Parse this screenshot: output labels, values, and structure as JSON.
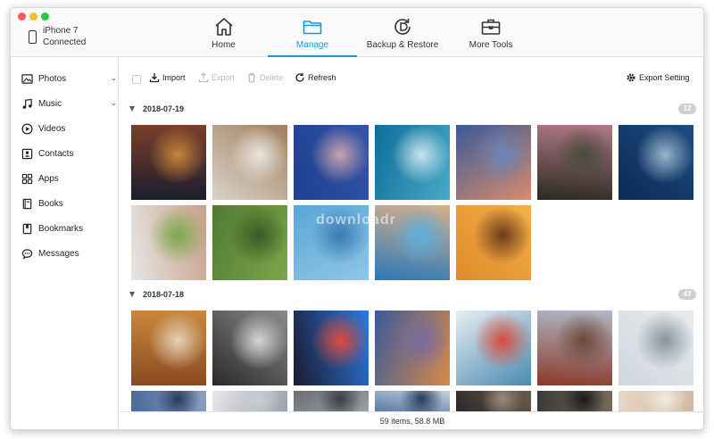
{
  "device": {
    "name": "iPhone 7",
    "status": "Connected"
  },
  "nav_tabs": [
    {
      "label": "Home",
      "icon": "home-icon",
      "active": false
    },
    {
      "label": "Manage",
      "icon": "folder-icon",
      "active": true
    },
    {
      "label": "Backup & Restore",
      "icon": "backup-restore-icon",
      "active": false
    },
    {
      "label": "More Tools",
      "icon": "toolbox-icon",
      "active": false
    }
  ],
  "sidebar": {
    "items": [
      {
        "label": "Photos",
        "icon": "photo-icon",
        "expandable": true
      },
      {
        "label": "Music",
        "icon": "music-note-icon",
        "expandable": true
      },
      {
        "label": "Videos",
        "icon": "play-circle-icon",
        "expandable": false
      },
      {
        "label": "Contacts",
        "icon": "contact-card-icon",
        "expandable": false
      },
      {
        "label": "Apps",
        "icon": "apps-grid-icon",
        "expandable": false
      },
      {
        "label": "Books",
        "icon": "book-icon",
        "expandable": false
      },
      {
        "label": "Bookmarks",
        "icon": "bookmark-icon",
        "expandable": false
      },
      {
        "label": "Messages",
        "icon": "chat-bubble-icon",
        "expandable": false
      }
    ]
  },
  "toolbar": {
    "import_label": "Import",
    "export_label": "Export",
    "delete_label": "Delete",
    "refresh_label": "Refresh",
    "export_setting_label": "Export Setting"
  },
  "groups": [
    {
      "date": "2018-07-19",
      "count": "12",
      "photos": [
        {
          "subject": "Night alley with lanterns",
          "colors": [
            "#1a1d2e",
            "#7a3f2a",
            "#c8843a"
          ]
        },
        {
          "subject": "Deer in snow",
          "colors": [
            "#d9d2c8",
            "#a07e5c",
            "#eae6df"
          ]
        },
        {
          "subject": "Cherry blossoms against blue sky",
          "colors": [
            "#1f3f8f",
            "#3355a8",
            "#c9a3b0"
          ]
        },
        {
          "subject": "Beluga whale underwater",
          "colors": [
            "#0e6e9a",
            "#4aa9c6",
            "#c8e4ec"
          ]
        },
        {
          "subject": "Coastal sunset",
          "colors": [
            "#3a5a9a",
            "#d98b6a",
            "#6b86b8"
          ]
        },
        {
          "subject": "Pink hydrangea",
          "colors": [
            "#2a2a22",
            "#b07a88",
            "#4a4a3a"
          ]
        },
        {
          "subject": "Ocean wave",
          "colors": [
            "#0c2a55",
            "#1d4c80",
            "#9ab4cc"
          ]
        },
        {
          "subject": "Washing hands at tap",
          "colors": [
            "#e6e6e6",
            "#c9a088",
            "#7aa84a"
          ]
        },
        {
          "subject": "Aerial rice terraces",
          "colors": [
            "#4f7a33",
            "#7ea64a",
            "#3a5a26"
          ]
        },
        {
          "subject": "Swimmer in pool",
          "colors": [
            "#5aa6d6",
            "#8fc6e6",
            "#3a7ab0"
          ]
        },
        {
          "subject": "Person on pool float",
          "colors": [
            "#2a78b8",
            "#d8b08a",
            "#5ab0e0"
          ]
        },
        {
          "subject": "Golden sunset sea",
          "colors": [
            "#e08a2a",
            "#f2b04a",
            "#6a3a1a"
          ]
        }
      ]
    },
    {
      "date": "2018-07-18",
      "count": "43",
      "photos": [
        {
          "subject": "Burger",
          "colors": [
            "#8a4a22",
            "#c9883a",
            "#e6d2b8"
          ]
        },
        {
          "subject": "Subway station",
          "colors": [
            "#2a2a2a",
            "#8a8a8a",
            "#d6d6d6"
          ]
        },
        {
          "subject": "iPhone app icons",
          "colors": [
            "#1a1a2e",
            "#2a7ae0",
            "#e04a3a"
          ]
        },
        {
          "subject": "City lights at dusk",
          "colors": [
            "#3a5a9a",
            "#d88a4a",
            "#7a6aa0"
          ]
        },
        {
          "subject": "Breakfast bowls",
          "colors": [
            "#e8eef2",
            "#4a8ab0",
            "#d84a3a"
          ]
        },
        {
          "subject": "Brick street buildings",
          "colors": [
            "#8a3a2a",
            "#b0b8c8",
            "#6a4a3a"
          ]
        },
        {
          "subject": "Phone on desk",
          "colors": [
            "#cfd6dc",
            "#e8ecef",
            "#8a949c"
          ]
        },
        {
          "subject": "Partial photo",
          "colors": [
            "#4a6a9a",
            "#8aa0c0",
            "#2a3a5a"
          ]
        },
        {
          "subject": "Partial photo",
          "colors": [
            "#e8e8ec",
            "#9aa0aa",
            "#c8ccd2"
          ]
        },
        {
          "subject": "Partial photo",
          "colors": [
            "#6a6e74",
            "#9aa0a6",
            "#3a3e44"
          ]
        },
        {
          "subject": "Partial photo",
          "colors": [
            "#5a7aa0",
            "#c0d0e0",
            "#2a3a5a"
          ]
        },
        {
          "subject": "Partial photo",
          "colors": [
            "#2a2a2a",
            "#6a5a4a",
            "#9a8a7a"
          ]
        },
        {
          "subject": "Partial photo",
          "colors": [
            "#3a3a3a",
            "#7a6a5a",
            "#1a1a1a"
          ]
        },
        {
          "subject": "Partial photo",
          "colors": [
            "#e8d8c8",
            "#d0b8a0",
            "#f2ece4"
          ]
        }
      ]
    }
  ],
  "status_text": "59 items, 58.8 MB",
  "watermark": "downloadr",
  "colors": {
    "accent": "#1a9ad6",
    "active_tab": "#1a9ad6",
    "badge": "#cfcfcf"
  }
}
